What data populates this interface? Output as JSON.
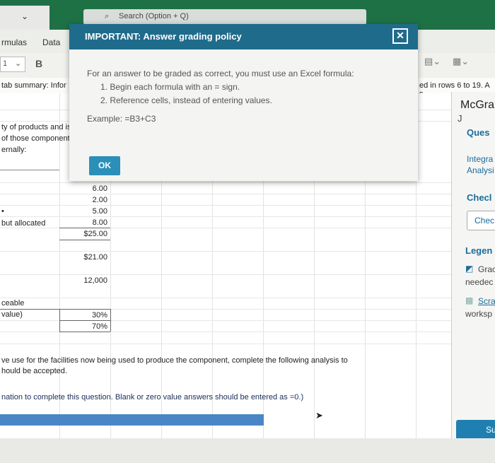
{
  "titlebar": {
    "search_placeholder": "Search (Option + Q)"
  },
  "ribbon_tabs": [
    "rmulas",
    "Data"
  ],
  "ribbon": {
    "cell_ref": "1",
    "bold": "B"
  },
  "formula_hint_left": "tab summary: Infor",
  "formula_hint_right": "ed in rows 6 to 19. A s",
  "sheet": {
    "desc_line1": "ty of products and is",
    "desc_line2": "of those component",
    "desc_line3": "ernally:",
    "bullet": "•",
    "but_allocated": "but allocated",
    "values": [
      "6.00",
      "2.00",
      "5.00",
      "8.00",
      "$25.00"
    ],
    "total_21": "$21.00",
    "units": "12,000",
    "ceable": "ceable",
    "value_label": "value)",
    "pct1": "30%",
    "pct2": "70%",
    "note_line1": "ve use for the facilities now being used to produce the component, complete the following analysis to",
    "note_line2": "hould be accepted.",
    "instruction": "nation to complete this question. Blank or zero value answers should be entered as =0.)"
  },
  "right_panel": {
    "col_j": "J",
    "brand": "McGra",
    "ques": "Ques",
    "integra": "Integra",
    "analysi": "Analysi",
    "check": "Checl",
    "check_btn": "Chec",
    "legend": "Legen",
    "grad": "Grac",
    "needed": "needec",
    "scra": "Scra",
    "worksp": "worksp",
    "submit": "Su"
  },
  "dialog": {
    "title": "IMPORTANT: Answer grading policy",
    "intro": "For an answer to be graded as correct, you must use an Excel formula:",
    "rule1": "1. Begin each formula with an = sign.",
    "rule2": "2. Reference cells, instead of entering values.",
    "example": "Example: =B3+C3",
    "ok": "OK",
    "close": "✕"
  },
  "colors": {
    "accent": "#1f6b8c",
    "excel_green": "#1e7145"
  }
}
